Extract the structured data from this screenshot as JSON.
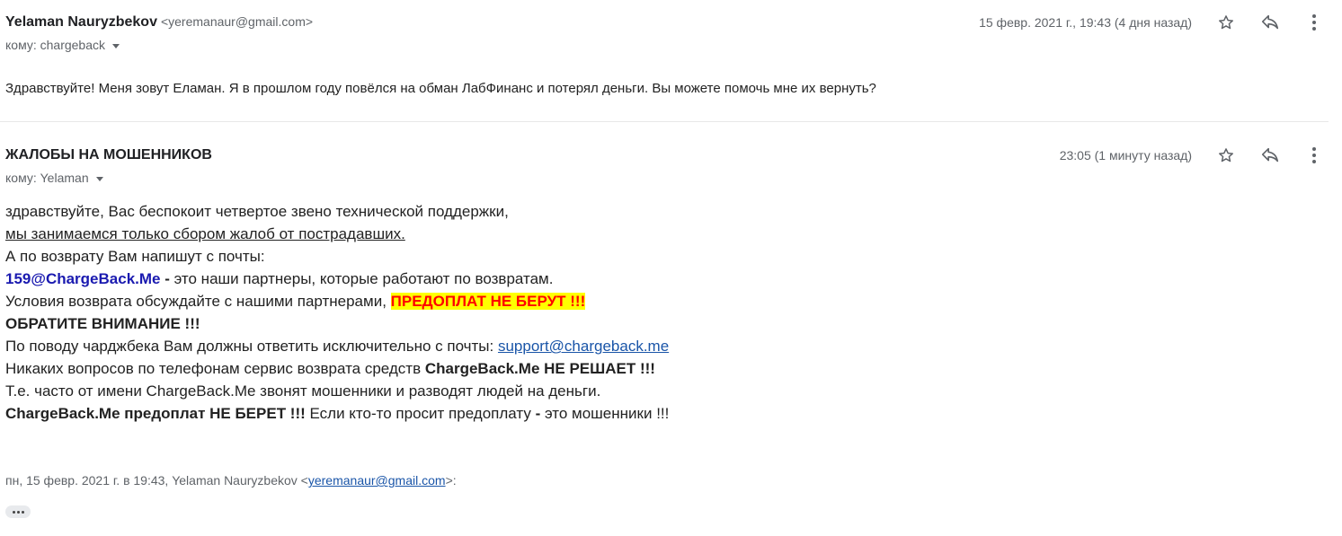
{
  "message1": {
    "sender_name": "Yelaman Nauryzbekov",
    "sender_email": "<yeremanaur@gmail.com>",
    "to_text": "кому: chargeback",
    "date": "15 февр. 2021 г., 19:43 (4 дня назад)",
    "body": "Здравствуйте! Меня зовут Еламан. Я в прошлом году повёлся на обман ЛабФинанс и потерял деньги. Вы можете помочь мне их вернуть?"
  },
  "message2": {
    "sender_name": "ЖАЛОБЫ НА МОШЕННИКОВ",
    "to_text": "кому: Yelaman",
    "date": "23:05 (1 минуту назад)",
    "body": {
      "line1": "здравствуйте, Вас беспокоит четвертое звено технической поддержки,",
      "line2": "мы занимаемся только сбором жалоб от пострадавших.",
      "line3": "А по возврату Вам напишут с почты:",
      "line4_email": "159@ChargeBack.Me",
      "line4_dash": " - ",
      "line4_rest": "это наши партнеры, которые работают по возвратам.",
      "line5_text": "Условия возврата обсуждайте с нашими партнерами, ",
      "line5_highlight": "ПРЕДОПЛАТ НЕ БЕРУТ !!!",
      "line6": "ОБРАТИТЕ ВНИМАНИЕ !!!",
      "line7_text": "По поводу чарджбека Вам должны ответить исключительно с почты: ",
      "line7_link": "support@chargeback.me",
      "line8_text": "Никаких вопросов по телефонам сервис возврата средств ",
      "line8_bold": "ChargeBack.Me НЕ РЕШАЕТ !!!",
      "line9": "Т.е. часто от имени ChargeBack.Me звонят мошенники и разводят людей на деньги.",
      "line10_bold1": "ChargeBack.Me предоплат НЕ БЕРЕТ !!!",
      "line10_text": " Если кто-то просит предоплату ",
      "line10_dash": "-",
      "line10_rest": " это мошенники !!!"
    },
    "quote_prefix": "пн, 15 февр. 2021 г. в 19:43, Yelaman Nauryzbekov <",
    "quote_email": "yeremanaur@gmail.com",
    "quote_suffix": ">:"
  },
  "icons": [
    "star-icon",
    "reply-icon",
    "more-vert-icon",
    "chevron-down-icon",
    "ellipsis-icon"
  ],
  "colors": {
    "highlight_bg": "#ffff00",
    "highlight_text": "#ff0000",
    "email_blue": "#1a1ab0",
    "link": "#1a55a8"
  }
}
